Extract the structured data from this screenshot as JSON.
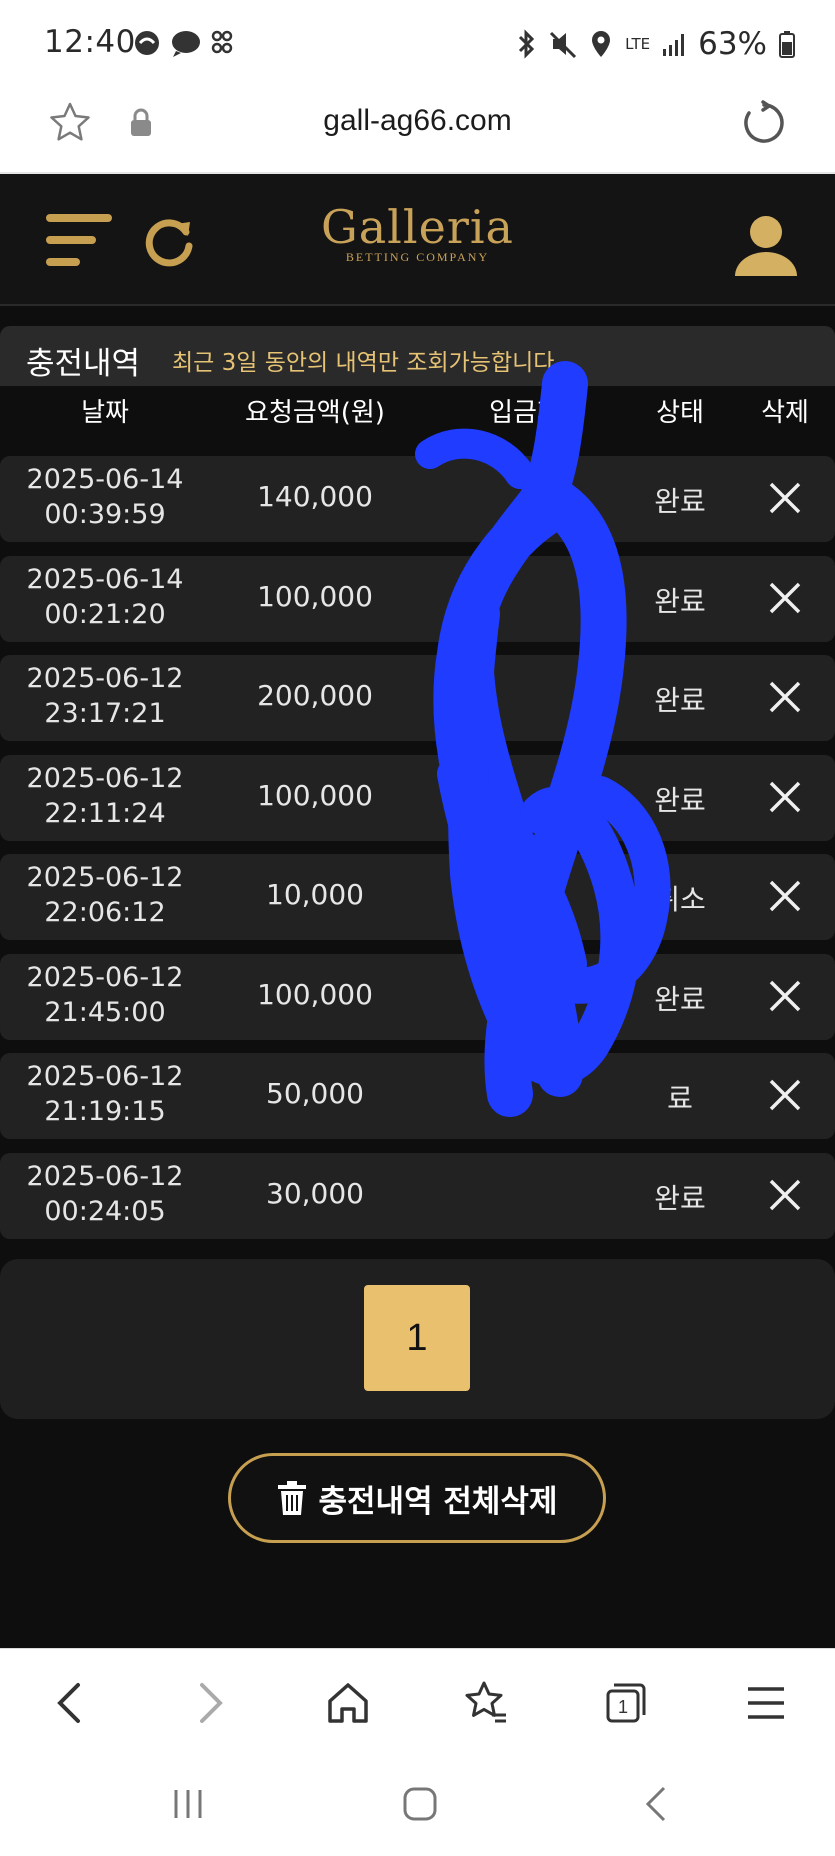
{
  "status_bar": {
    "time": "12:40",
    "battery": "63%",
    "network": "LTE",
    "icons": [
      "notification-icon",
      "chat-icon",
      "apps-icon",
      "bluetooth-icon",
      "mute-icon",
      "location-icon",
      "signal-icon",
      "battery-icon"
    ]
  },
  "browser": {
    "url": "gall-ag66.com"
  },
  "site": {
    "logo_name": "Galleria",
    "logo_sub": "BETTING COMPANY",
    "accent": "#c9a259",
    "page_title": "충전내역",
    "note": "최근 3일 동안의 내역만 조회가능합니다",
    "columns": {
      "date": "날짜",
      "amount": "요청금액(원)",
      "depositor": "입금자",
      "status": "상태",
      "delete": "삭제"
    },
    "rows": [
      {
        "date": "2025-06-14",
        "time": "00:39:59",
        "amount": "140,000",
        "depositor": "",
        "status": "완료"
      },
      {
        "date": "2025-06-14",
        "time": "00:21:20",
        "amount": "100,000",
        "depositor": "",
        "status": "완료"
      },
      {
        "date": "2025-06-12",
        "time": "23:17:21",
        "amount": "200,000",
        "depositor": "",
        "status": "완료"
      },
      {
        "date": "2025-06-12",
        "time": "22:11:24",
        "amount": "100,000",
        "depositor": "",
        "status": "완료"
      },
      {
        "date": "2025-06-12",
        "time": "22:06:12",
        "amount": "10,000",
        "depositor": "",
        "status": "취소"
      },
      {
        "date": "2025-06-12",
        "time": "21:45:00",
        "amount": "100,000",
        "depositor": "",
        "status": "완료"
      },
      {
        "date": "2025-06-12",
        "time": "21:19:15",
        "amount": "50,000",
        "depositor": "",
        "status": "료"
      },
      {
        "date": "2025-06-12",
        "time": "00:24:05",
        "amount": "30,000",
        "depositor": "",
        "status": "완료"
      }
    ],
    "pagination": {
      "current_page": "1"
    },
    "delete_all_label": "충전내역 전체삭제",
    "redaction_color": "#1f3cff"
  }
}
